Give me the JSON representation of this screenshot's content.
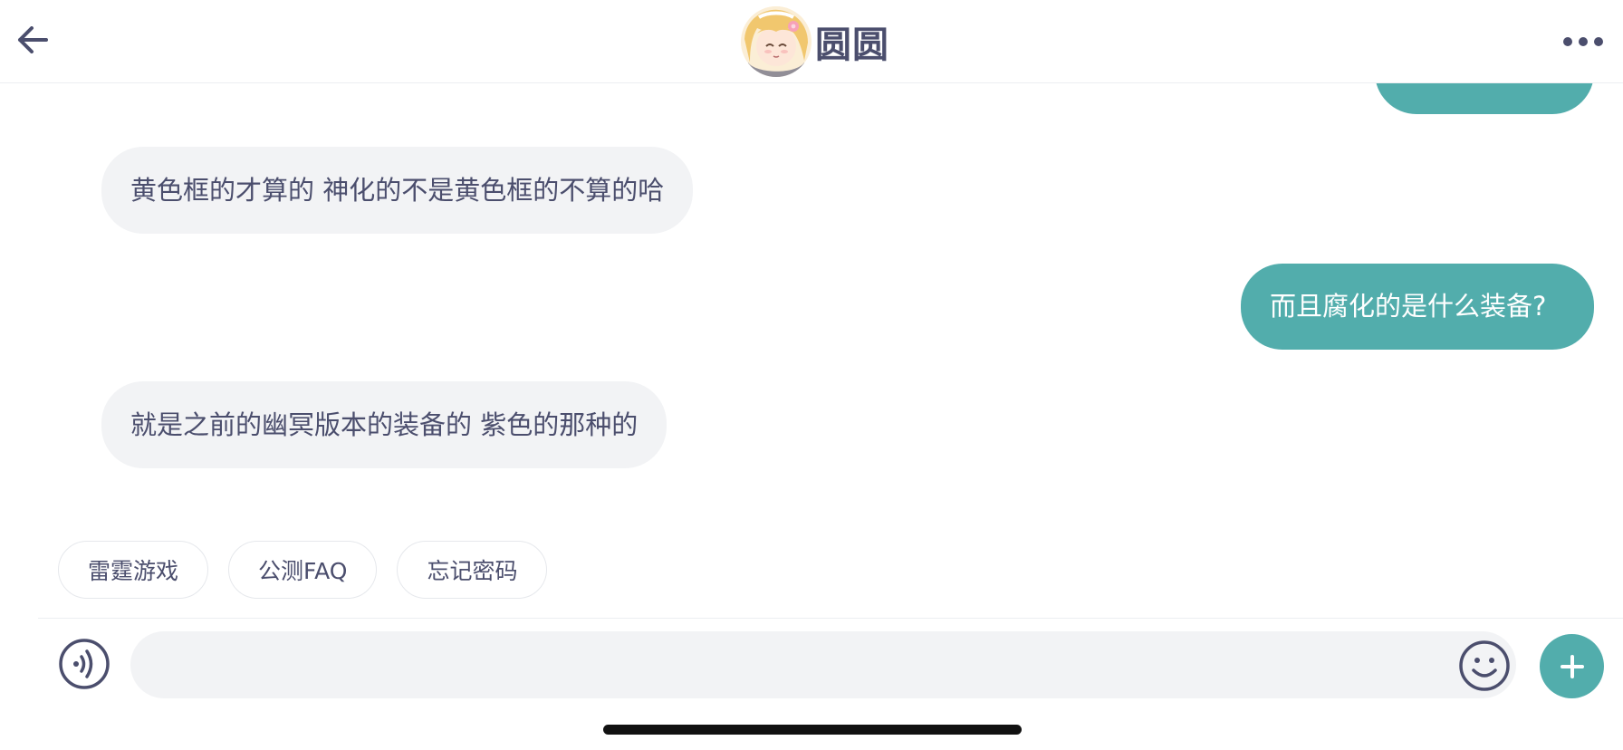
{
  "header": {
    "title": "圆圆",
    "back_icon": "arrow-left-icon",
    "more_icon": "more-dots-icon",
    "avatar": "avatar-anime-girl"
  },
  "messages": [
    {
      "side": "out",
      "text": ""
    },
    {
      "side": "in",
      "text": "黄色框的才算的 神化的不是黄色框的不算的哈"
    },
    {
      "side": "out",
      "text": "而且腐化的是什么装备?"
    },
    {
      "side": "in",
      "text": "就是之前的幽冥版本的装备的 紫色的那种的"
    }
  ],
  "quick_replies": [
    "雷霆游戏",
    "公测FAQ",
    "忘记密码"
  ],
  "input": {
    "placeholder": "",
    "value": "",
    "voice_icon": "voice-icon",
    "emoji_icon": "smiley-icon",
    "plus_icon": "plus-icon"
  },
  "colors": {
    "accent": "#52adac",
    "incoming_bubble": "#f2f3f5",
    "text": "#4b4e6d"
  }
}
